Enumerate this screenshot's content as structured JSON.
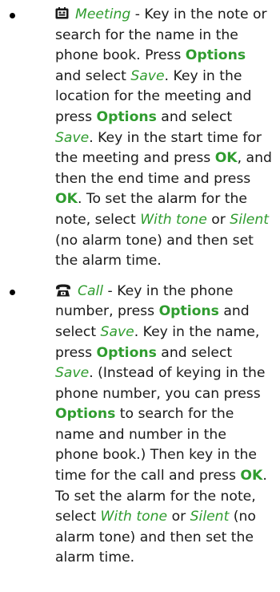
{
  "colors": {
    "accent_green": "#2f9c2f",
    "text": "#1a1a1a"
  },
  "items": [
    {
      "icon": "meeting-icon",
      "segments": [
        {
          "t": "Meeting",
          "s": "title"
        },
        {
          "t": " - Key in the note or search for the name in the phone book. Press ",
          "s": "plain"
        },
        {
          "t": "Options",
          "s": "key"
        },
        {
          "t": " and select ",
          "s": "plain"
        },
        {
          "t": "Save",
          "s": "em"
        },
        {
          "t": ". Key in the location for the meeting and press ",
          "s": "plain"
        },
        {
          "t": "Options",
          "s": "key"
        },
        {
          "t": " and select ",
          "s": "plain"
        },
        {
          "t": "Save",
          "s": "em"
        },
        {
          "t": ". Key in the start time for the meeting and press ",
          "s": "plain"
        },
        {
          "t": "OK",
          "s": "key"
        },
        {
          "t": ", and then the end time and press ",
          "s": "plain"
        },
        {
          "t": "OK",
          "s": "key"
        },
        {
          "t": ". To set the alarm for the note, select ",
          "s": "plain"
        },
        {
          "t": "With tone",
          "s": "em"
        },
        {
          "t": " or ",
          "s": "plain"
        },
        {
          "t": "Silent",
          "s": "em"
        },
        {
          "t": " (no alarm tone) and then set the alarm time.",
          "s": "plain"
        }
      ]
    },
    {
      "icon": "phone-icon",
      "segments": [
        {
          "t": "Call",
          "s": "title"
        },
        {
          "t": " - Key in the phone number, press ",
          "s": "plain"
        },
        {
          "t": "Options",
          "s": "key"
        },
        {
          "t": " and select ",
          "s": "plain"
        },
        {
          "t": "Save",
          "s": "em"
        },
        {
          "t": ". Key in the name, press ",
          "s": "plain"
        },
        {
          "t": "Options",
          "s": "key"
        },
        {
          "t": " and select ",
          "s": "plain"
        },
        {
          "t": "Save",
          "s": "em"
        },
        {
          "t": ". (Instead of keying in the phone number, you can press ",
          "s": "plain"
        },
        {
          "t": "Options",
          "s": "key"
        },
        {
          "t": " to search for the name and number in the phone book.) Then key in the time for the call and press ",
          "s": "plain"
        },
        {
          "t": "OK",
          "s": "key"
        },
        {
          "t": ". To set the alarm for the note, select ",
          "s": "plain"
        },
        {
          "t": "With tone",
          "s": "em"
        },
        {
          "t": " or ",
          "s": "plain"
        },
        {
          "t": "Silent",
          "s": "em"
        },
        {
          "t": " (no alarm tone) and then set the alarm time.",
          "s": "plain"
        }
      ]
    }
  ]
}
